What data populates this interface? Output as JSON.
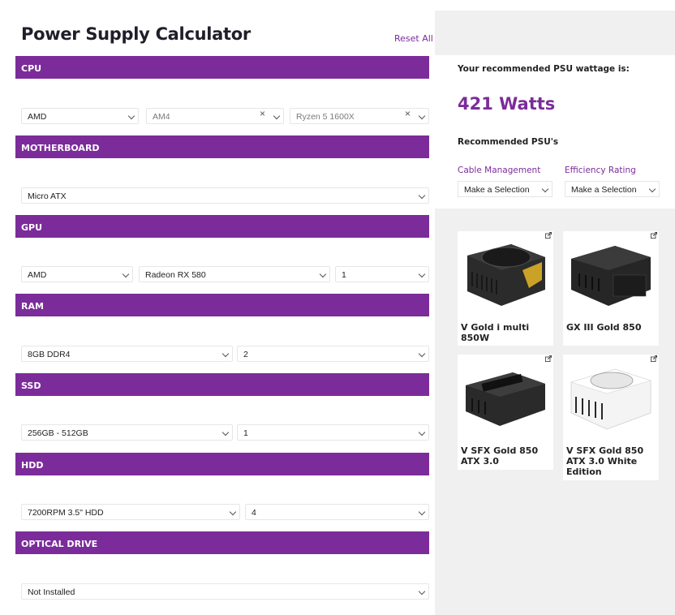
{
  "header": {
    "title": "Power Supply Calculator",
    "reset_label": "Reset All"
  },
  "sections": {
    "cpu": {
      "label": "CPU",
      "brand": "AMD",
      "socket": "AM4",
      "model": "Ryzen 5 1600X"
    },
    "motherboard": {
      "label": "MOTHERBOARD",
      "form_factor": "Micro ATX"
    },
    "gpu": {
      "label": "GPU",
      "brand": "AMD",
      "model": "Radeon RX 580",
      "quantity": "1"
    },
    "ram": {
      "label": "RAM",
      "type": "8GB DDR4",
      "quantity": "2"
    },
    "ssd": {
      "label": "SSD",
      "size": "256GB - 512GB",
      "quantity": "1"
    },
    "hdd": {
      "label": "HDD",
      "type": "7200RPM 3.5\" HDD",
      "quantity": "4"
    },
    "optical": {
      "label": "OPTICAL DRIVE",
      "value": "Not Installed"
    }
  },
  "result": {
    "label": "Your recommended PSU wattage is:",
    "wattage": "421 Watts",
    "recommended_title": "Recommended PSU's"
  },
  "filters": {
    "cable_label": "Cable Management",
    "cable_value": "Make a Selection",
    "efficiency_label": "Efficiency Rating",
    "efficiency_value": "Make a Selection"
  },
  "products": [
    {
      "name": "V Gold i multi 850W",
      "color": "black"
    },
    {
      "name": "GX III Gold 850",
      "color": "black"
    },
    {
      "name": "V SFX Gold 850 ATX 3.0",
      "color": "black"
    },
    {
      "name": "V SFX Gold 850 ATX 3.0 White Edition",
      "color": "white"
    }
  ],
  "colors": {
    "accent": "#7b2c9a",
    "panel_bg": "#f0f0f0"
  }
}
